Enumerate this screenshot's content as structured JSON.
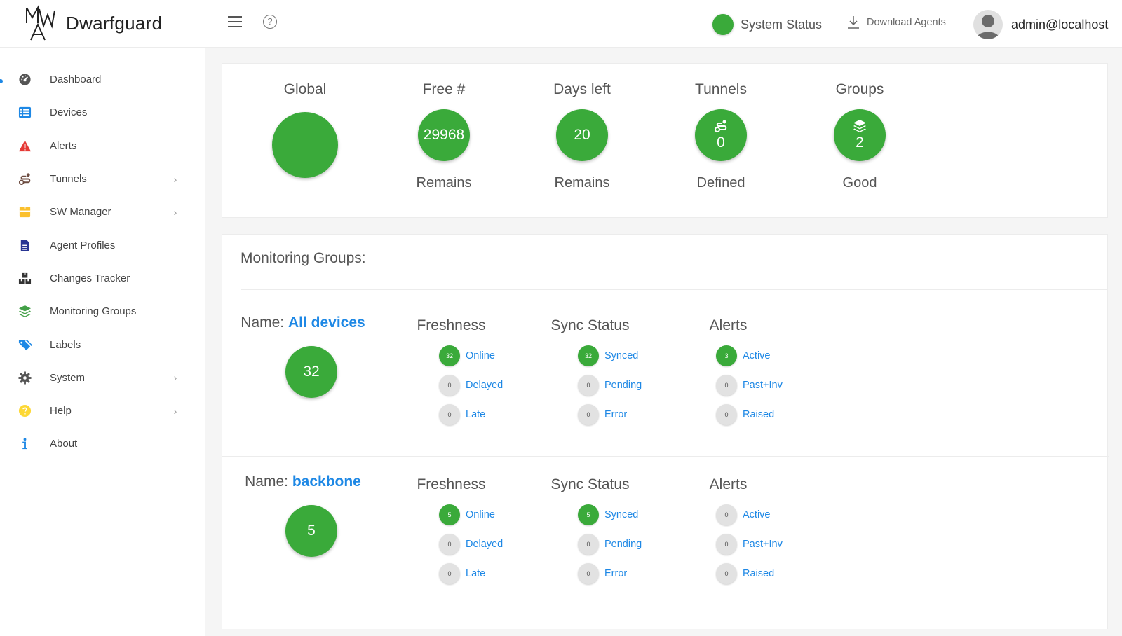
{
  "brand": {
    "name": "Dwarfguard",
    "logo_text": "MWA"
  },
  "sidebar": {
    "items": [
      {
        "label": "Dashboard",
        "icon": "dashboard-icon",
        "color": "#555555",
        "chevron": false,
        "active": true
      },
      {
        "label": "Devices",
        "icon": "list-icon",
        "color": "#1e88e5",
        "chevron": false
      },
      {
        "label": "Alerts",
        "icon": "warning-icon",
        "color": "#e53935",
        "chevron": false
      },
      {
        "label": "Tunnels",
        "icon": "route-icon",
        "color": "#6d4c41",
        "chevron": true
      },
      {
        "label": "SW Manager",
        "icon": "box-icon",
        "color": "#fbc02d",
        "chevron": true
      },
      {
        "label": "Agent Profiles",
        "icon": "file-icon",
        "color": "#283593",
        "chevron": false
      },
      {
        "label": "Changes Tracker",
        "icon": "boxes-icon",
        "color": "#333333",
        "chevron": false
      },
      {
        "label": "Monitoring Groups",
        "icon": "layers-icon",
        "color": "#43a047",
        "chevron": false
      },
      {
        "label": "Labels",
        "icon": "tags-icon",
        "color": "#1e88e5",
        "chevron": false
      },
      {
        "label": "System",
        "icon": "gear-icon",
        "color": "#555555",
        "chevron": true
      },
      {
        "label": "Help",
        "icon": "help-circle-icon",
        "color": "#fdd835",
        "chevron": true
      },
      {
        "label": "About",
        "icon": "info-icon",
        "color": "#1e88e5",
        "chevron": false
      }
    ]
  },
  "header": {
    "system_status": "System Status",
    "download_agents": "Download Agents",
    "user": "admin@localhost",
    "help_glyph": "?"
  },
  "stats": [
    {
      "title": "Global",
      "value": "",
      "sub": "",
      "icon": ""
    },
    {
      "title": "Free #",
      "value": "29968",
      "sub": "Remains",
      "icon": ""
    },
    {
      "title": "Days left",
      "value": "20",
      "sub": "Remains",
      "icon": ""
    },
    {
      "title": "Tunnels",
      "value": "0",
      "sub": "Defined",
      "icon": "route-icon"
    },
    {
      "title": "Groups",
      "value": "2",
      "sub": "Good",
      "icon": "layers-icon"
    }
  ],
  "monitoring": {
    "title": "Monitoring Groups:",
    "name_prefix": "Name:",
    "column_titles": {
      "freshness": "Freshness",
      "sync": "Sync Status",
      "alerts": "Alerts"
    },
    "groups": [
      {
        "name": "All devices",
        "count": "32",
        "freshness": [
          {
            "v": "32",
            "label": "Online"
          },
          {
            "v": "0",
            "label": "Delayed"
          },
          {
            "v": "0",
            "label": "Late"
          }
        ],
        "sync": [
          {
            "v": "32",
            "label": "Synced"
          },
          {
            "v": "0",
            "label": "Pending"
          },
          {
            "v": "0",
            "label": "Error"
          }
        ],
        "alerts": [
          {
            "v": "3",
            "label": "Active"
          },
          {
            "v": "0",
            "label": "Past+Inv"
          },
          {
            "v": "0",
            "label": "Raised"
          }
        ]
      },
      {
        "name": "backbone",
        "count": "5",
        "freshness": [
          {
            "v": "5",
            "label": "Online"
          },
          {
            "v": "0",
            "label": "Delayed"
          },
          {
            "v": "0",
            "label": "Late"
          }
        ],
        "sync": [
          {
            "v": "5",
            "label": "Synced"
          },
          {
            "v": "0",
            "label": "Pending"
          },
          {
            "v": "0",
            "label": "Error"
          }
        ],
        "alerts": [
          {
            "v": "0",
            "label": "Active"
          },
          {
            "v": "0",
            "label": "Past+Inv"
          },
          {
            "v": "0",
            "label": "Raised"
          }
        ]
      }
    ]
  },
  "colors": {
    "green": "#3aaa3a",
    "link": "#1e88e5",
    "grey_pill": "#e2e2e2"
  }
}
